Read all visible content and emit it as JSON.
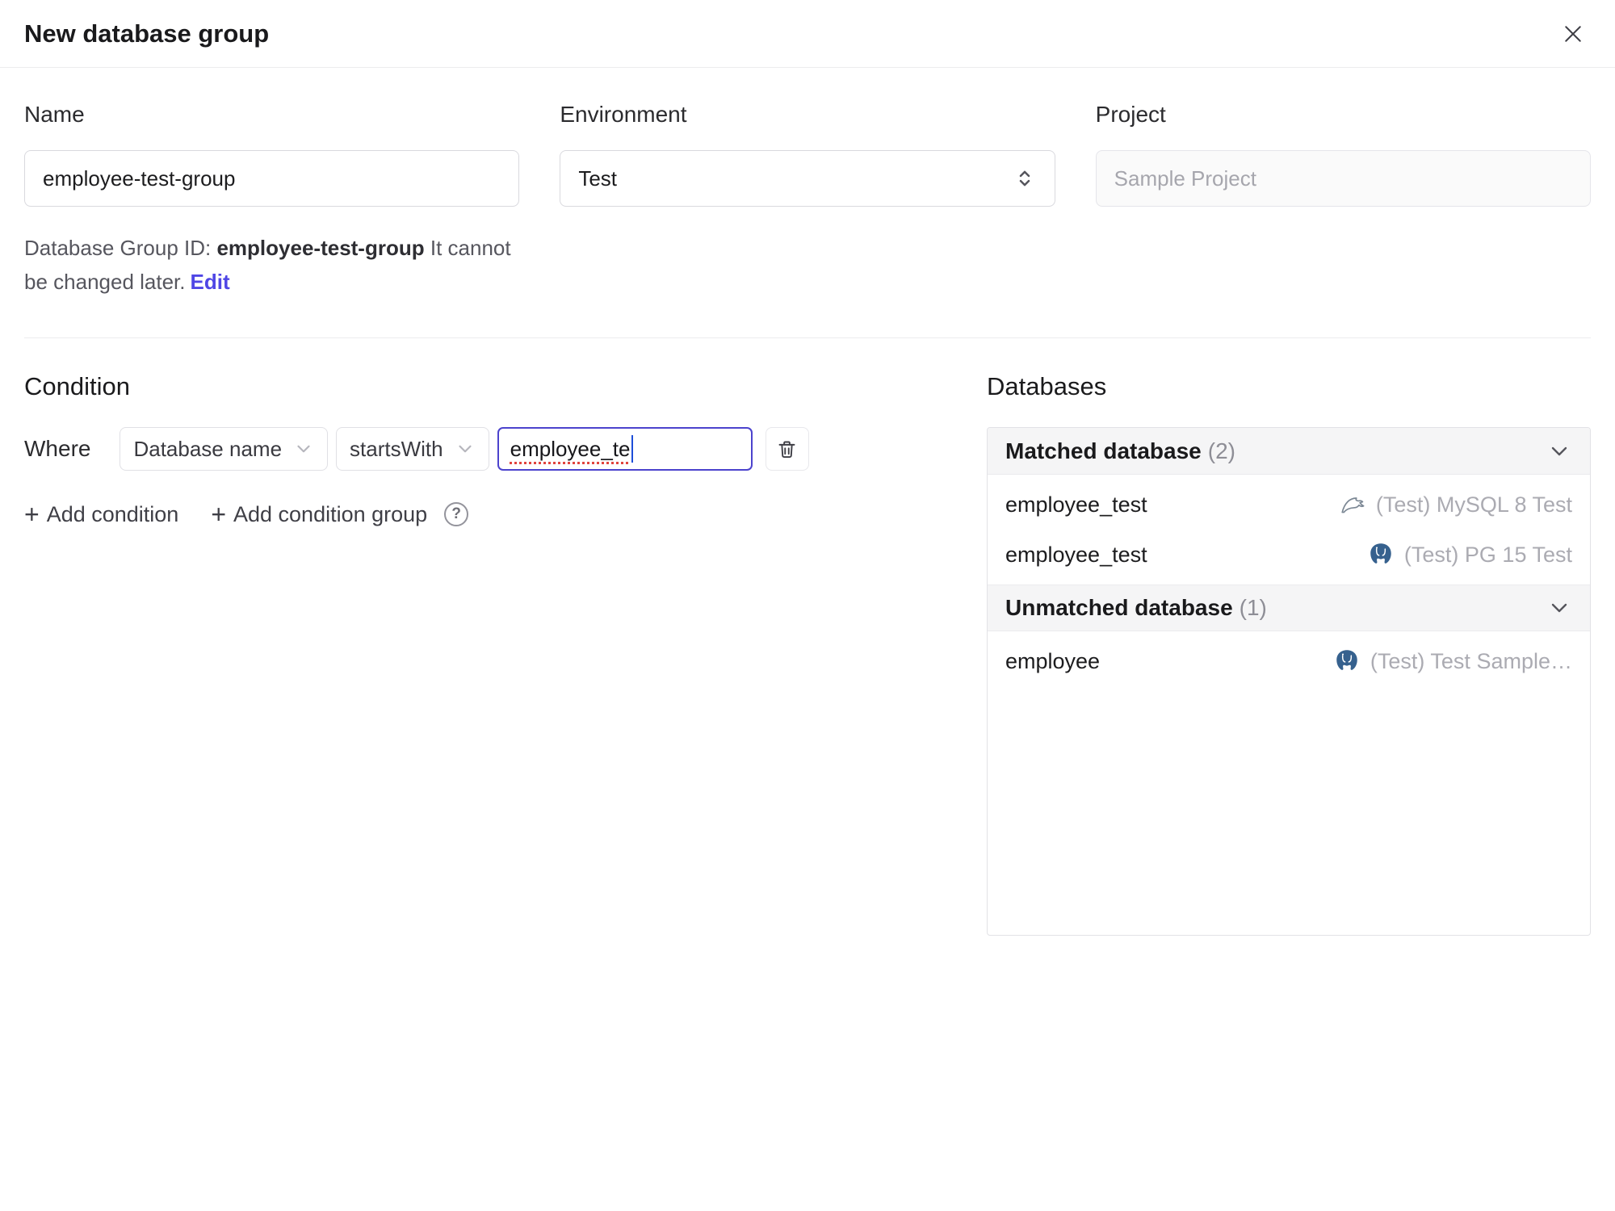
{
  "header": {
    "title": "New database group"
  },
  "icons": {
    "plus": "+",
    "help": "?"
  },
  "form": {
    "name": {
      "label": "Name",
      "value": "employee-test-group"
    },
    "environment": {
      "label": "Environment",
      "value": "Test"
    },
    "project": {
      "label": "Project",
      "value": "Sample Project"
    },
    "group_id_hint": {
      "prefix": "Database Group ID: ",
      "id": "employee-test-group",
      "suffix": " It cannot be changed later.",
      "edit_label": "Edit"
    }
  },
  "condition": {
    "title": "Condition",
    "where_label": "Where",
    "field": "Database name",
    "operator": "startsWith",
    "value": "employee_te",
    "add_condition": "Add condition",
    "add_condition_group": "Add condition group"
  },
  "databases": {
    "title": "Databases",
    "groups": [
      {
        "label": "Matched database",
        "count": "(2)",
        "rows": [
          {
            "name": "employee_test",
            "engine": "mysql",
            "instance": "(Test) MySQL 8 Test"
          },
          {
            "name": "employee_test",
            "engine": "postgres",
            "instance": "(Test) PG 15 Test"
          }
        ]
      },
      {
        "label": "Unmatched database",
        "count": "(1)",
        "rows": [
          {
            "name": "employee",
            "engine": "postgres",
            "instance": "(Test) Test Sample…"
          }
        ]
      }
    ]
  }
}
